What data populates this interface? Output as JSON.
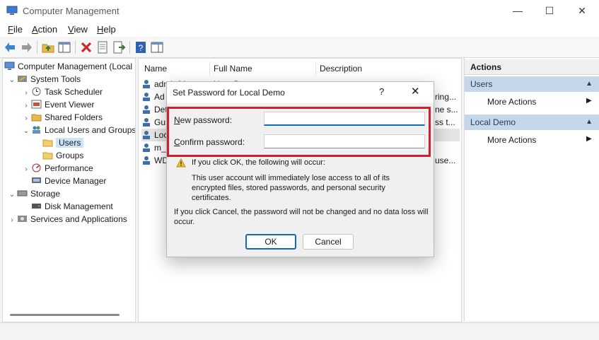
{
  "window": {
    "title": "Computer Management",
    "controls": {
      "minimize": "—",
      "maximize": "☐",
      "close": "✕"
    }
  },
  "menu": [
    {
      "label": "File",
      "mnemonic": "F",
      "rest": "ile"
    },
    {
      "label": "Action",
      "mnemonic": "A",
      "rest": "ction"
    },
    {
      "label": "View",
      "mnemonic": "V",
      "rest": "iew"
    },
    {
      "label": "Help",
      "mnemonic": "H",
      "rest": "elp"
    }
  ],
  "toolbar": {
    "icons": [
      "back-arrow-icon",
      "forward-arrow-icon",
      "up-folder-icon",
      "show-hide-tree-icon",
      "delete-icon",
      "properties-icon",
      "export-list-icon",
      "help-icon",
      "action-pane-icon"
    ]
  },
  "tree": {
    "root": "Computer Management (Local",
    "system_tools": "System Tools",
    "task_scheduler": "Task Scheduler",
    "event_viewer": "Event Viewer",
    "shared_folders": "Shared Folders",
    "local_users_groups": "Local Users and Groups",
    "users": "Users",
    "groups": "Groups",
    "performance": "Performance",
    "device_manager": "Device Manager",
    "storage": "Storage",
    "disk_management": "Disk Management",
    "services_apps": "Services and Applications"
  },
  "list": {
    "columns": {
      "name": "Name",
      "full_name": "Full Name",
      "description": "Description"
    },
    "rows": [
      {
        "name": "admin01",
        "full_name": "User Demo",
        "description": ""
      },
      {
        "name": "Ad",
        "full_name": "",
        "description": "ring..."
      },
      {
        "name": "Det",
        "full_name": "",
        "description": "ne s..."
      },
      {
        "name": "Gu",
        "full_name": "",
        "description": "ss t..."
      },
      {
        "name": "Loc",
        "full_name": "",
        "description": ""
      },
      {
        "name": "m_",
        "full_name": "",
        "description": ""
      },
      {
        "name": "WD",
        "full_name": "",
        "description": "use..."
      }
    ]
  },
  "actions": {
    "title": "Actions",
    "sections": [
      {
        "label": "Users",
        "item": "More Actions"
      },
      {
        "label": "Local Demo",
        "item": "More Actions"
      }
    ]
  },
  "dialog": {
    "title": "Set Password for Local Demo",
    "help": "?",
    "close": "✕",
    "new_password_label": {
      "mnemonic": "N",
      "rest": "ew password:"
    },
    "confirm_password_label": {
      "mnemonic": "C",
      "rest": "onfirm password:"
    },
    "new_password_value": "",
    "confirm_password_value": "",
    "warning_heading": "If you click OK, the following will occur:",
    "warning_body": "This user account will immediately lose access to all of its encrypted files, stored passwords, and personal security certificates.",
    "cancel_note": "If you click Cancel, the password will not be changed and no data loss will occur.",
    "ok_label": "OK",
    "cancel_label": "Cancel",
    "highlight_color": "#d0202f",
    "accent_color": "#0f6cbd"
  }
}
